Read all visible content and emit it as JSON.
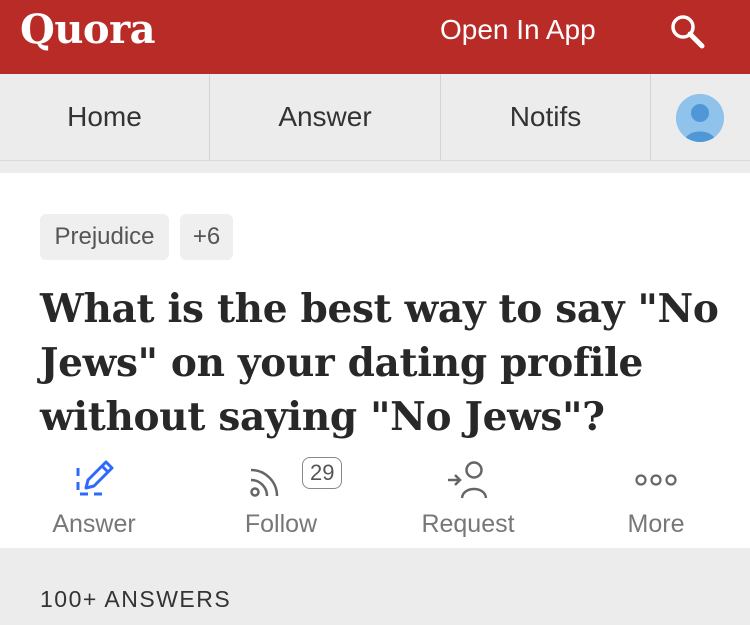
{
  "header": {
    "logo": "Quora",
    "open_app": "Open In App",
    "brand_color": "#b92b27"
  },
  "nav": {
    "items": [
      "Home",
      "Answer",
      "Notifs"
    ]
  },
  "question": {
    "topics": [
      "Prejudice",
      "+6"
    ],
    "title": "What is the best way to say \"No Jews\" on your dating profile without saying \"No Jews\"?"
  },
  "actions": {
    "answer": "Answer",
    "follow": "Follow",
    "follow_count": "29",
    "request": "Request",
    "more": "More"
  },
  "answers": {
    "count_label": "100+ ANSWERS"
  },
  "icons": [
    "search-icon",
    "avatar-icon",
    "pencil-icon",
    "rss-icon",
    "request-person-icon",
    "more-dots-icon"
  ]
}
